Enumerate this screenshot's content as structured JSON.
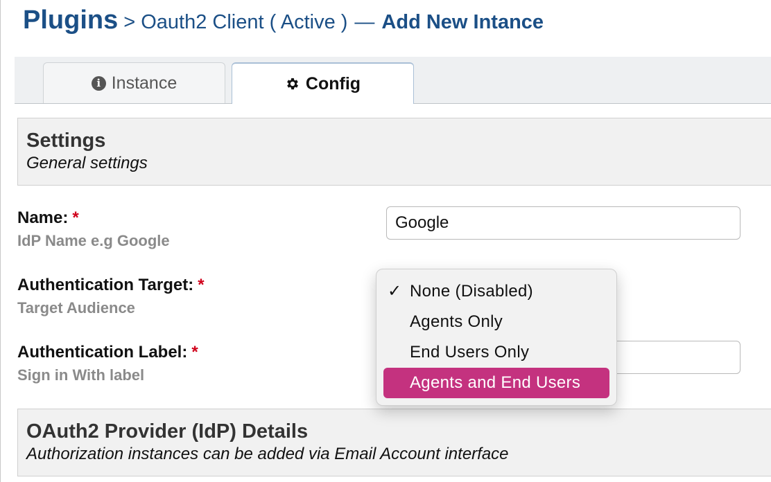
{
  "header": {
    "title": "Plugins",
    "breadcrumb": "> Oauth2 Client ( Active )",
    "separator": "—",
    "page": "Add New Intance"
  },
  "tabs": [
    {
      "label": "Instance",
      "icon": "info-circle-icon",
      "active": false
    },
    {
      "label": "Config",
      "icon": "gear-icon",
      "active": true
    }
  ],
  "settings": {
    "title": "Settings",
    "subtitle": "General settings"
  },
  "fields": {
    "name": {
      "label": "Name:",
      "required": "*",
      "hint": "IdP Name e.g Google",
      "value": "Google"
    },
    "auth_target": {
      "label": "Authentication Target:",
      "required": "*",
      "hint": "Target Audience"
    },
    "auth_label": {
      "label": "Authentication Label:",
      "required": "*",
      "hint": "Sign in With label",
      "value": ""
    }
  },
  "dropdown": {
    "checkmark": "✓",
    "options": [
      "None (Disabled)",
      "Agents Only",
      "End Users Only",
      "Agents and End Users"
    ],
    "checked_index": 0,
    "highlighted_index": 3,
    "highlight_color": "#c4327f"
  },
  "oauth": {
    "title": "OAuth2 Provider (IdP) Details",
    "subtitle": "Authorization instances can be added via Email Account interface"
  },
  "colors": {
    "header": "#1b4f86",
    "required": "#d0021b"
  }
}
